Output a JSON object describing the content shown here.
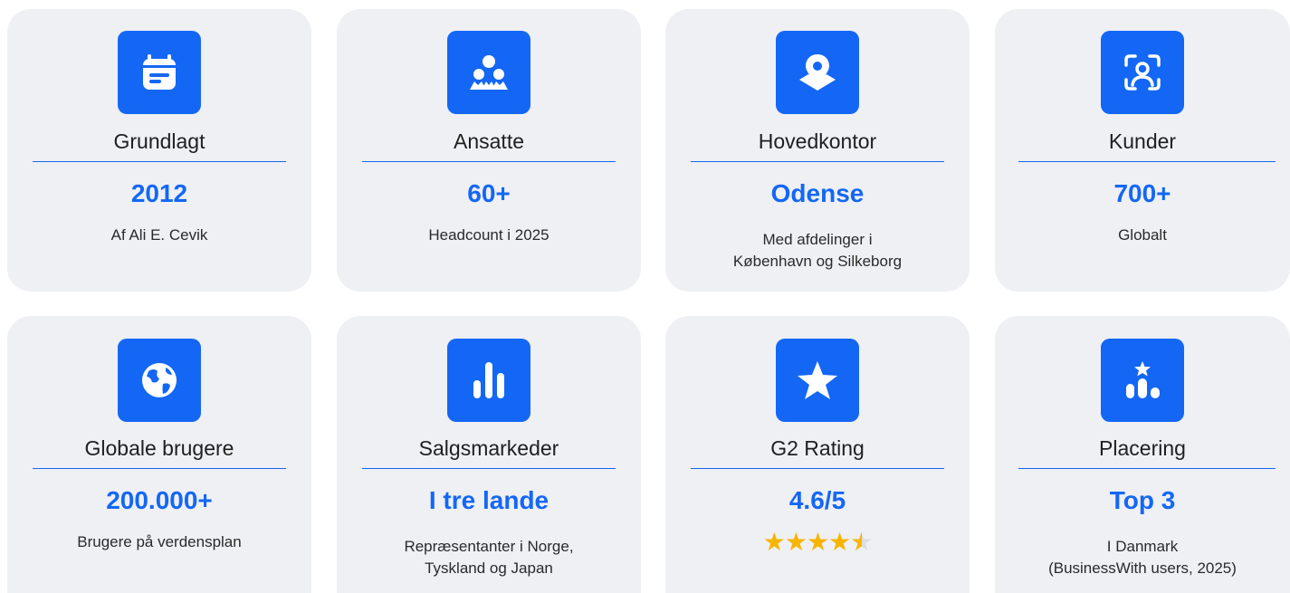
{
  "colors": {
    "accent": "#1467f5",
    "card_bg": "#eef0f4",
    "star": "#f7b500"
  },
  "cards": [
    {
      "icon": "calendar-icon",
      "label": "Grundlagt",
      "value": "2012",
      "sub": [
        "Af Ali E. Cevik"
      ]
    },
    {
      "icon": "people-group-icon",
      "label": "Ansatte",
      "value": "60+",
      "sub": [
        "Headcount i 2025"
      ]
    },
    {
      "icon": "location-pin-icon",
      "label": "Hovedkontor",
      "value": "Odense",
      "sub": [
        "Med afdelinger i",
        "København og Silkeborg"
      ]
    },
    {
      "icon": "user-scan-icon",
      "label": "Kunder",
      "value": "700+",
      "sub": [
        "Globalt"
      ]
    },
    {
      "icon": "globe-icon",
      "label": "Globale brugere",
      "value": "200.000+",
      "sub": [
        "Brugere på verdensplan"
      ]
    },
    {
      "icon": "bar-chart-icon",
      "label": "Salgsmarkeder",
      "value": "I tre lande",
      "sub": [
        "Repræsentanter i Norge,",
        "Tyskland og Japan"
      ]
    },
    {
      "icon": "star-icon",
      "label": "G2 Rating",
      "value": "4.6/5",
      "rating": 4.6,
      "rating_max": 5
    },
    {
      "icon": "podium-star-icon",
      "label": "Placering",
      "value": "Top 3",
      "sub": [
        "I Danmark",
        "(BusinessWith users, 2025)"
      ]
    }
  ]
}
